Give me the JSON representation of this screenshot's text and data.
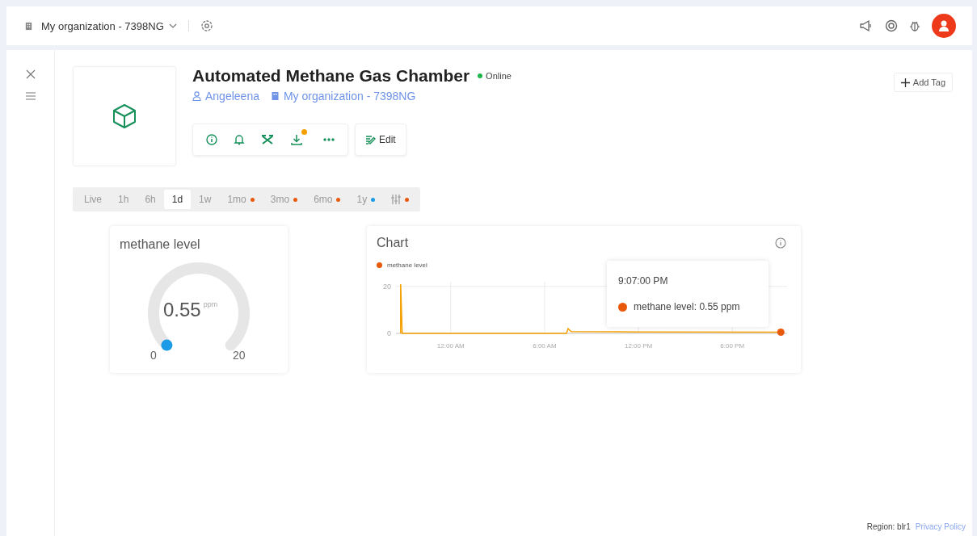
{
  "topbar": {
    "organization": "My organization - 7398NG"
  },
  "device": {
    "title": "Automated Methane Gas Chamber",
    "status": "Online",
    "online": true,
    "owner": "Angeleena",
    "organization": "My organization - 7398NG",
    "download_badge": true,
    "edit": "Edit",
    "add_tag": "Add Tag"
  },
  "time_ranges": [
    {
      "label": "Live",
      "selected": false
    },
    {
      "label": "1h",
      "selected": false
    },
    {
      "label": "6h",
      "selected": false
    },
    {
      "label": "1d",
      "selected": true
    },
    {
      "label": "1w",
      "selected": false
    },
    {
      "label": "1mo",
      "selected": false,
      "color": "#e8590c"
    },
    {
      "label": "3mo",
      "selected": false,
      "color": "#e8590c"
    },
    {
      "label": "6mo",
      "selected": false,
      "color": "#e8590c"
    },
    {
      "label": "1y",
      "selected": false,
      "color": "#1c9be6"
    },
    {
      "kind": "custom",
      "selected": false,
      "color": "#e8590c"
    }
  ],
  "gauge": {
    "title": "methane level",
    "value": "0.55",
    "unit": "ppm",
    "min": "0",
    "max": "20"
  },
  "chart": {
    "title": "Chart",
    "tooltip": {
      "time": "9:07:00 PM",
      "text": "methane level: 0.55 ppm"
    },
    "chart_data": {
      "type": "line",
      "x": [
        -3.2,
        -3.2,
        -3.1,
        7.4,
        7.5,
        7.7,
        12,
        21.1
      ],
      "series": [
        {
          "name": "methane level",
          "color": "#f59f00",
          "values": [
            0,
            21,
            0,
            0,
            2,
            0.8,
            0.6,
            0.5
          ]
        }
      ],
      "grid": true,
      "xlim": [
        -3.5,
        21.5
      ],
      "ylim": [
        0,
        22
      ],
      "xticks": [
        {
          "value": 0,
          "label": "12:00 AM"
        },
        {
          "value": 6,
          "label": "6:00 AM"
        },
        {
          "value": 12,
          "label": "12:00 PM"
        },
        {
          "value": 18,
          "label": "6:00 PM"
        }
      ],
      "yticks": [
        0,
        20
      ]
    }
  },
  "footer": {
    "region": "Region: blr1",
    "privacy": "Privacy Policy"
  }
}
